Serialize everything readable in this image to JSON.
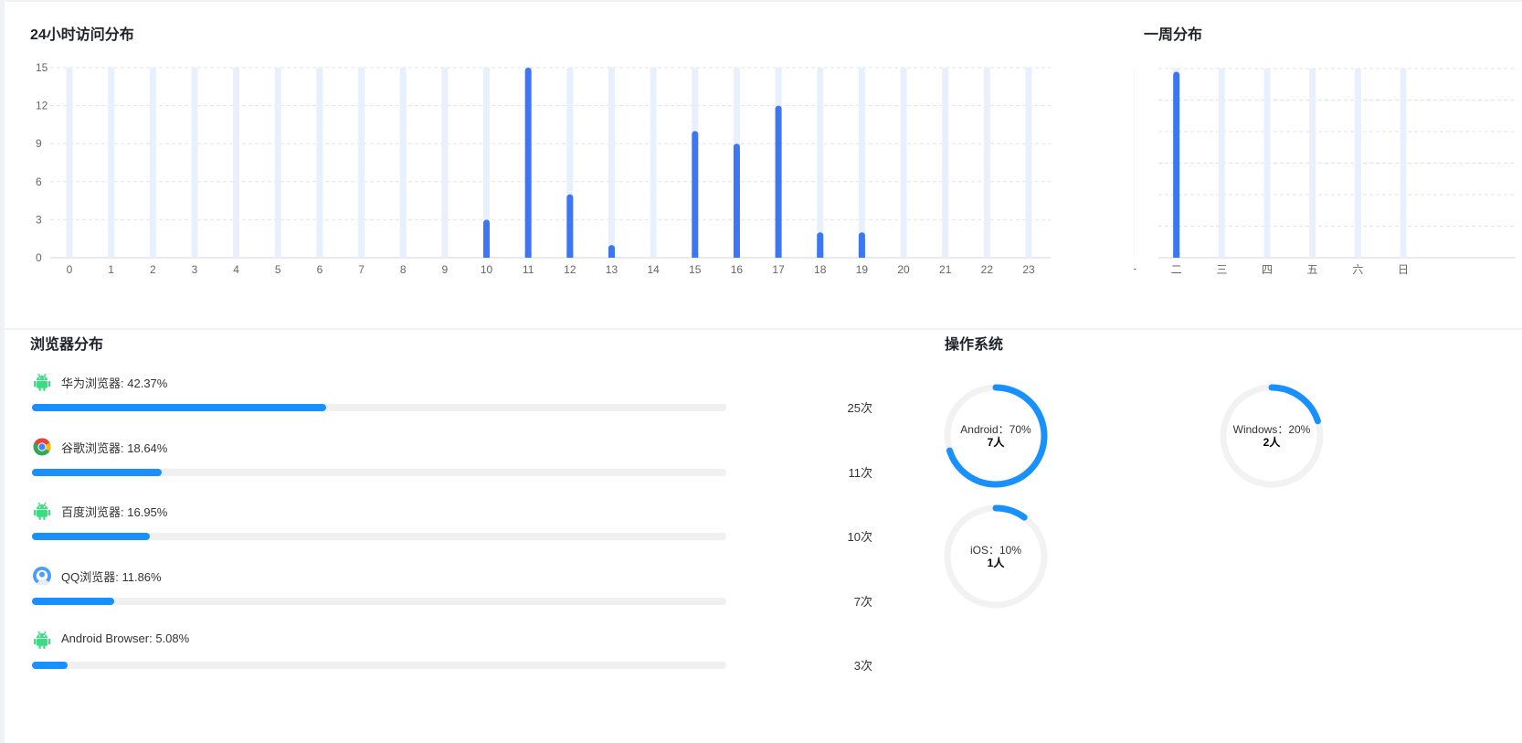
{
  "hourly_panel": {
    "title": "24小时访问分布"
  },
  "weekly_panel": {
    "title": "一周分布"
  },
  "browser_panel": {
    "title": "浏览器分布",
    "items": [
      {
        "name": "华为浏览器",
        "percent": "42.37%",
        "fraction": 0.4237,
        "count": "25次",
        "icon": "android-icon"
      },
      {
        "name": "谷歌浏览器",
        "percent": "18.64%",
        "fraction": 0.1864,
        "count": "11次",
        "icon": "chrome-icon"
      },
      {
        "name": "百度浏览器",
        "percent": "16.95%",
        "fraction": 0.1695,
        "count": "10次",
        "icon": "android-icon"
      },
      {
        "name": "QQ浏览器",
        "percent": "11.86%",
        "fraction": 0.1186,
        "count": "7次",
        "icon": "qq-browser-icon"
      },
      {
        "name": "Android Browser",
        "percent": "5.08%",
        "fraction": 0.0508,
        "count": "3次",
        "icon": "android-icon"
      }
    ]
  },
  "os_panel": {
    "title": "操作系统",
    "items": [
      {
        "name": "Android",
        "percent": "70%",
        "fraction": 0.7,
        "count": "7人"
      },
      {
        "name": "Windows",
        "percent": "20%",
        "fraction": 0.2,
        "count": "2人"
      },
      {
        "name": "iOS",
        "percent": "10%",
        "fraction": 0.1,
        "count": "1人"
      }
    ]
  },
  "colors": {
    "bar": "#3c76f5",
    "bar_background": "#e8f0fe",
    "progress": "#1890ff",
    "ring": "#1890ff",
    "ring_track": "#f2f2f2",
    "android": "#3ddc84"
  },
  "chart_data": [
    {
      "type": "bar",
      "title": "24小时访问分布",
      "categories": [
        "0",
        "1",
        "2",
        "3",
        "4",
        "5",
        "6",
        "7",
        "8",
        "9",
        "10",
        "11",
        "12",
        "13",
        "14",
        "15",
        "16",
        "17",
        "18",
        "19",
        "20",
        "21",
        "22",
        "23"
      ],
      "values": [
        0,
        0,
        0,
        0,
        0,
        0,
        0,
        0,
        0,
        0,
        3,
        15,
        5,
        1,
        0,
        10,
        9,
        12,
        2,
        2,
        0,
        0,
        0,
        0
      ],
      "yticks": [
        0,
        3,
        6,
        9,
        12,
        15
      ],
      "ylim": [
        0,
        15
      ],
      "grid": true
    },
    {
      "type": "bar",
      "title": "一周分布",
      "categories": [
        "一",
        "二",
        "三",
        "四",
        "五",
        "六",
        "日"
      ],
      "values": [
        0,
        59,
        0,
        0,
        0,
        0,
        0
      ],
      "yticks": [
        0,
        10,
        20,
        30,
        40,
        50,
        60
      ],
      "ylim": [
        0,
        60
      ],
      "grid": true
    }
  ]
}
